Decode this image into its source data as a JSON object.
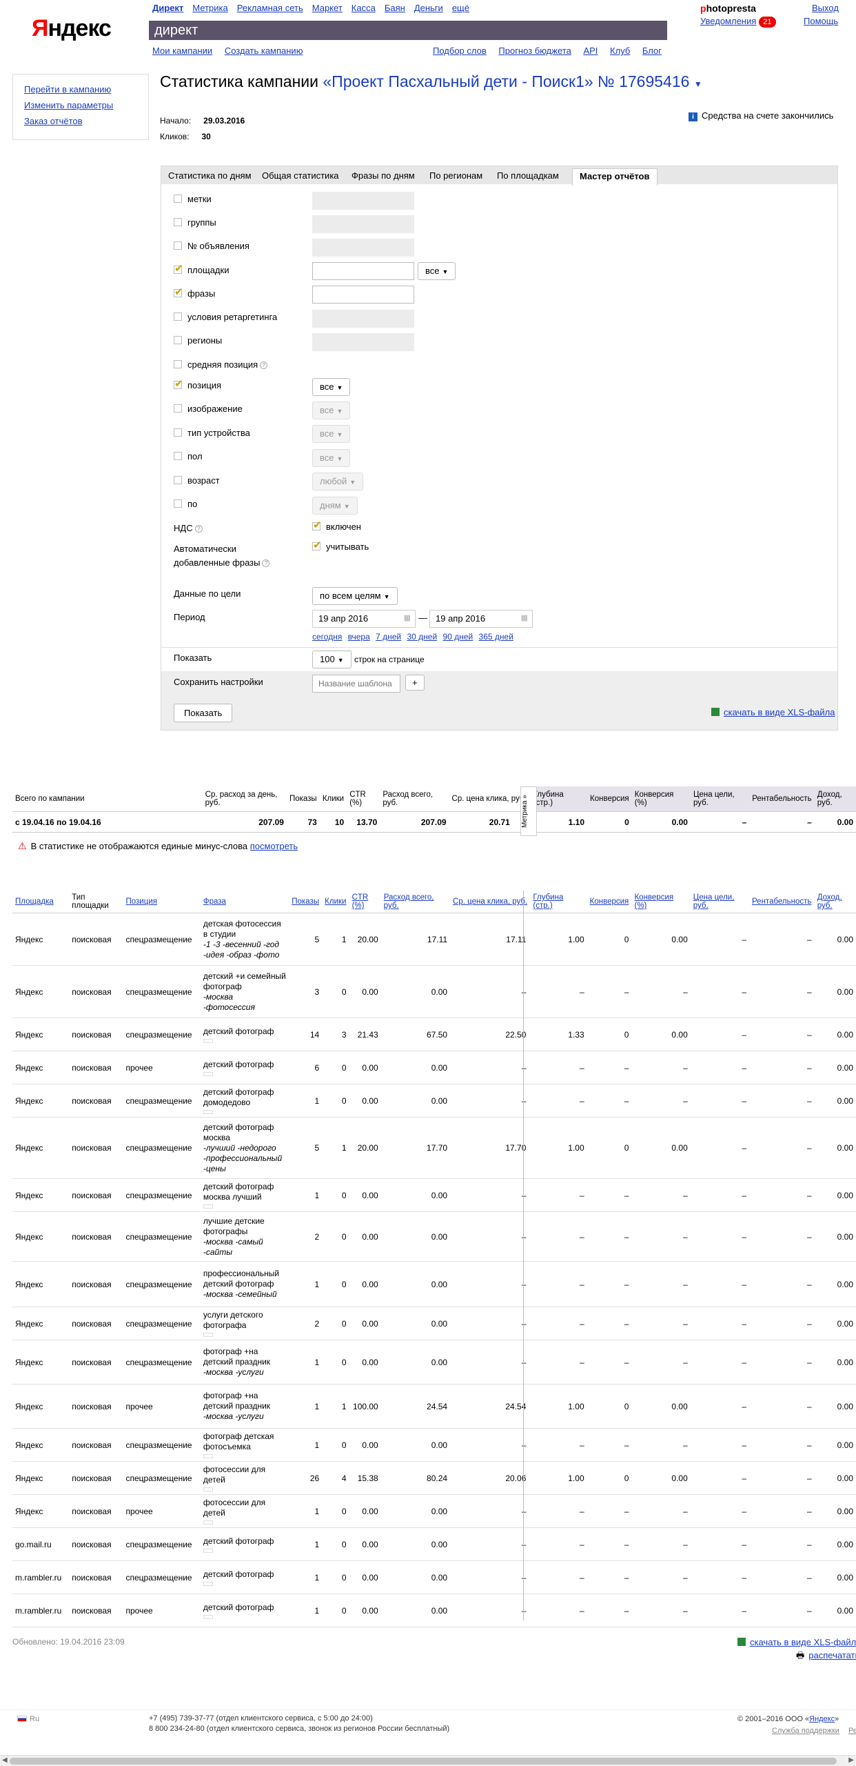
{
  "header": {
    "logo": "Яндекс",
    "topnav": [
      {
        "label": "Директ",
        "current": true
      },
      {
        "label": "Метрика"
      },
      {
        "label": "Рекламная сеть"
      },
      {
        "label": "Маркет"
      },
      {
        "label": "Касса"
      },
      {
        "label": "Баян"
      },
      {
        "label": "Деньги"
      },
      {
        "label": "ещё"
      }
    ],
    "service": "директ",
    "subnav_left": [
      "Мои кампании",
      "Создать кампанию"
    ],
    "subnav_right": [
      "Подбор слов",
      "Прогноз бюджета",
      "API",
      "Клуб",
      "Блог"
    ],
    "user_p": "p",
    "user_rest": "hotopresta",
    "notify_label": "Уведомления",
    "notify_count": "21",
    "exit": "Выход",
    "help": "Помощь"
  },
  "sidebar": {
    "links": [
      "Перейти в кампанию",
      "Изменить параметры",
      "Заказ отчётов"
    ]
  },
  "campaign": {
    "title_prefix": "Статистика кампании",
    "name": "«Проект Пасхальный дети - Поиск1» № 17695416",
    "start_label": "Начало:",
    "start_value": "29.03.2016",
    "clicks_label": "Кликов:",
    "clicks_value": "30",
    "funds_notice": "Средства на счете закончились"
  },
  "tabs": [
    "Статистика по дням",
    "Общая статистика",
    "Фразы по дням",
    "По регионам",
    "По площадкам",
    "Мастер отчётов"
  ],
  "filters": {
    "metki": "метки",
    "groups": "группы",
    "ad_no": "№ объявления",
    "sites": "площадки",
    "sites_select": "все",
    "phrases": "фразы",
    "retarget": "условия ретаргетинга",
    "regions": "регионы",
    "avg_pos": "средняя позиция",
    "position": "позиция",
    "position_select": "все",
    "image": "изображение",
    "image_select": "все",
    "device": "тип устройства",
    "device_select": "все",
    "gender": "пол",
    "gender_select": "все",
    "age": "возраст",
    "age_select": "любой",
    "by": "по",
    "by_select": "дням",
    "vat": "НДС",
    "vat_opt": "включен",
    "auto_phrases_1": "Автоматически",
    "auto_phrases_2": "добавленные фразы",
    "auto_opt": "учитывать",
    "goal_label": "Данные по цели",
    "goal_select": "по всем целям",
    "period_label": "Период",
    "date_from": "19 апр 2016",
    "date_to": "19 апр 2016",
    "dash": "—",
    "quick": [
      "сегодня",
      "вчера",
      "7 дней",
      "30 дней",
      "90 дней",
      "365 дней"
    ],
    "show_label": "Показать",
    "rows_select": "100",
    "rows_suffix": "строк на странице",
    "save_label": "Сохранить настройки",
    "save_placeholder": "Название шаблона",
    "plus": "+",
    "show_button": "Показать",
    "xls_link": "скачать в виде XLS-файла"
  },
  "summary": {
    "headers": [
      "Всего по кампании",
      "Ср. расход за день, руб.",
      "Показы",
      "Клики",
      "CTR (%)",
      "Расход всего, руб.",
      "Ср. цена клика, руб.",
      "Глубина (стр.)",
      "Конверсия",
      "Конверсия (%)",
      "Цена цели, руб.",
      "Рентабельность",
      "Доход, руб."
    ],
    "row": [
      "с 19.04.16 по 19.04.16",
      "207.09",
      "73",
      "10",
      "13.70",
      "207.09",
      "20.71",
      "1.10",
      "0",
      "0.00",
      "–",
      "–",
      "0.00"
    ],
    "metrika": "Метрика »"
  },
  "warning": {
    "text": "В статистике не отображаются единые минус-слова",
    "link": "посмотреть"
  },
  "detail": {
    "headers": [
      "Площадка",
      "Тип площадки",
      "Позиция",
      "Фраза",
      "Показы",
      "Клики",
      "CTR (%)",
      "Расход всего, руб.",
      "Ср. цена клика, руб.",
      "Глубина (стр.)",
      "Конверсия",
      "Конверсия (%)",
      "Цена цели, руб.",
      "Рентабельность",
      "Доход, руб."
    ],
    "rows": [
      {
        "site": "Яндекс",
        "type": "поисковая",
        "pos": "спецразмещение",
        "phrase": "детская фотосессия в студии",
        "minus": "-1 -3 -весенний -год -идея -образ -фото",
        "shows": "5",
        "clicks": "1",
        "ctr": "20.00",
        "cost": "17.11",
        "cpc": "17.11",
        "depth": "1.00",
        "conv": "0",
        "convp": "0.00",
        "goal": "–",
        "rent": "–",
        "income": "0.00",
        "h": 76
      },
      {
        "site": "Яндекс",
        "type": "поисковая",
        "pos": "спецразмещение",
        "phrase": "детский +и семейный фотограф",
        "minus": "-москва -фотосессия",
        "shows": "3",
        "clicks": "0",
        "ctr": "0.00",
        "cost": "0.00",
        "cpc": "–",
        "depth": "–",
        "conv": "–",
        "convp": "–",
        "goal": "–",
        "rent": "–",
        "income": "0.00",
        "h": 76
      },
      {
        "site": "Яндекс",
        "type": "поисковая",
        "pos": "спецразмещение",
        "phrase": "детский фотограф",
        "minus": "",
        "shows": "14",
        "clicks": "3",
        "ctr": "21.43",
        "cost": "67.50",
        "cpc": "22.50",
        "depth": "1.33",
        "conv": "0",
        "convp": "0.00",
        "goal": "–",
        "rent": "–",
        "income": "0.00",
        "h": 48
      },
      {
        "site": "Яндекс",
        "type": "поисковая",
        "pos": "прочее",
        "phrase": "детский фотограф",
        "minus": "",
        "shows": "6",
        "clicks": "0",
        "ctr": "0.00",
        "cost": "0.00",
        "cpc": "–",
        "depth": "–",
        "conv": "–",
        "convp": "–",
        "goal": "–",
        "rent": "–",
        "income": "0.00",
        "h": 48
      },
      {
        "site": "Яндекс",
        "type": "поисковая",
        "pos": "спецразмещение",
        "phrase": "детский фотограф домодедово",
        "minus": "",
        "shows": "1",
        "clicks": "0",
        "ctr": "0.00",
        "cost": "0.00",
        "cpc": "–",
        "depth": "–",
        "conv": "–",
        "convp": "–",
        "goal": "–",
        "rent": "–",
        "income": "0.00",
        "h": 48
      },
      {
        "site": "Яндекс",
        "type": "поисковая",
        "pos": "спецразмещение",
        "phrase": "детский фотограф москва",
        "minus": "-лучший -недорого -профессиональный -цены",
        "shows": "5",
        "clicks": "1",
        "ctr": "20.00",
        "cost": "17.70",
        "cpc": "17.70",
        "depth": "1.00",
        "conv": "0",
        "convp": "0.00",
        "goal": "–",
        "rent": "–",
        "income": "0.00",
        "h": 89
      },
      {
        "site": "Яндекс",
        "type": "поисковая",
        "pos": "спецразмещение",
        "phrase": "детский фотограф москва лучший",
        "minus": "",
        "shows": "1",
        "clicks": "0",
        "ctr": "0.00",
        "cost": "0.00",
        "cpc": "–",
        "depth": "–",
        "conv": "–",
        "convp": "–",
        "goal": "–",
        "rent": "–",
        "income": "0.00",
        "h": 48
      },
      {
        "site": "Яндекс",
        "type": "поисковая",
        "pos": "спецразмещение",
        "phrase": "лучшие детские фотографы",
        "minus": "-москва -самый -сайты",
        "shows": "2",
        "clicks": "0",
        "ctr": "0.00",
        "cost": "0.00",
        "cpc": "–",
        "depth": "–",
        "conv": "–",
        "convp": "–",
        "goal": "–",
        "rent": "–",
        "income": "0.00",
        "h": 72
      },
      {
        "site": "Яндекс",
        "type": "поисковая",
        "pos": "спецразмещение",
        "phrase": "профессиональный детский фотограф",
        "minus": "-москва -семейный",
        "shows": "1",
        "clicks": "0",
        "ctr": "0.00",
        "cost": "0.00",
        "cpc": "–",
        "depth": "–",
        "conv": "–",
        "convp": "–",
        "goal": "–",
        "rent": "–",
        "income": "0.00",
        "h": 66
      },
      {
        "site": "Яндекс",
        "type": "поисковая",
        "pos": "спецразмещение",
        "phrase": "услуги детского фотографа",
        "minus": "",
        "shows": "2",
        "clicks": "0",
        "ctr": "0.00",
        "cost": "0.00",
        "cpc": "–",
        "depth": "–",
        "conv": "–",
        "convp": "–",
        "goal": "–",
        "rent": "–",
        "income": "0.00",
        "h": 48
      },
      {
        "site": "Яндекс",
        "type": "поисковая",
        "pos": "спецразмещение",
        "phrase": "фотограф +на детский праздник",
        "minus": "-москва -услуги",
        "shows": "1",
        "clicks": "0",
        "ctr": "0.00",
        "cost": "0.00",
        "cpc": "–",
        "depth": "–",
        "conv": "–",
        "convp": "–",
        "goal": "–",
        "rent": "–",
        "income": "0.00",
        "h": 64
      },
      {
        "site": "Яндекс",
        "type": "поисковая",
        "pos": "прочее",
        "phrase": "фотограф +на детский праздник",
        "minus": "-москва -услуги",
        "shows": "1",
        "clicks": "1",
        "ctr": "100.00",
        "cost": "24.54",
        "cpc": "24.54",
        "depth": "1.00",
        "conv": "0",
        "convp": "0.00",
        "goal": "–",
        "rent": "–",
        "income": "0.00",
        "h": 64
      },
      {
        "site": "Яндекс",
        "type": "поисковая",
        "pos": "спецразмещение",
        "phrase": "фотограф детская фотосъемка",
        "minus": "",
        "shows": "1",
        "clicks": "0",
        "ctr": "0.00",
        "cost": "0.00",
        "cpc": "–",
        "depth": "–",
        "conv": "–",
        "convp": "–",
        "goal": "–",
        "rent": "–",
        "income": "0.00",
        "h": 48
      },
      {
        "site": "Яндекс",
        "type": "поисковая",
        "pos": "спецразмещение",
        "phrase": "фотосессии для детей",
        "minus": "",
        "shows": "26",
        "clicks": "4",
        "ctr": "15.38",
        "cost": "80.24",
        "cpc": "20.06",
        "depth": "1.00",
        "conv": "0",
        "convp": "0.00",
        "goal": "–",
        "rent": "–",
        "income": "0.00",
        "h": 48
      },
      {
        "site": "Яндекс",
        "type": "поисковая",
        "pos": "прочее",
        "phrase": "фотосессии для детей",
        "minus": "",
        "shows": "1",
        "clicks": "0",
        "ctr": "0.00",
        "cost": "0.00",
        "cpc": "–",
        "depth": "–",
        "conv": "–",
        "convp": "–",
        "goal": "–",
        "rent": "–",
        "income": "0.00",
        "h": 48
      },
      {
        "site": "go.mail.ru",
        "type": "поисковая",
        "pos": "спецразмещение",
        "phrase": "детский фотограф",
        "minus": "",
        "shows": "1",
        "clicks": "0",
        "ctr": "0.00",
        "cost": "0.00",
        "cpc": "–",
        "depth": "–",
        "conv": "–",
        "convp": "–",
        "goal": "–",
        "rent": "–",
        "income": "0.00",
        "h": 48
      },
      {
        "site": "m.rambler.ru",
        "type": "поисковая",
        "pos": "спецразмещение",
        "phrase": "детский фотограф",
        "minus": "",
        "shows": "1",
        "clicks": "0",
        "ctr": "0.00",
        "cost": "0.00",
        "cpc": "–",
        "depth": "–",
        "conv": "–",
        "convp": "–",
        "goal": "–",
        "rent": "–",
        "income": "0.00",
        "h": 48
      },
      {
        "site": "m.rambler.ru",
        "type": "поисковая",
        "pos": "прочее",
        "phrase": "детский фотограф",
        "minus": "",
        "shows": "1",
        "clicks": "0",
        "ctr": "0.00",
        "cost": "0.00",
        "cpc": "–",
        "depth": "–",
        "conv": "–",
        "convp": "–",
        "goal": "–",
        "rent": "–",
        "income": "0.00",
        "h": 48
      }
    ]
  },
  "bottom": {
    "updated": "Обновлено: 19.04.2016 23:09",
    "xls_link": "скачать в виде XLS-файла",
    "print": "распечатать"
  },
  "footer": {
    "lang": "Ru",
    "phone1": "+7 (495) 739-37-77 (отдел клиентского сервиса, с 5:00 до 24:00)",
    "phone2": "8 800 234-24-80 (отдел клиентского сервиса, звонок из регионов России бесплатный)",
    "copyright_prefix": "© 2001–2016 ООО «",
    "copyright_link": "Яндекс",
    "copyright_suffix": "»",
    "links": [
      "Служба поддержки",
      "Реклама"
    ]
  }
}
